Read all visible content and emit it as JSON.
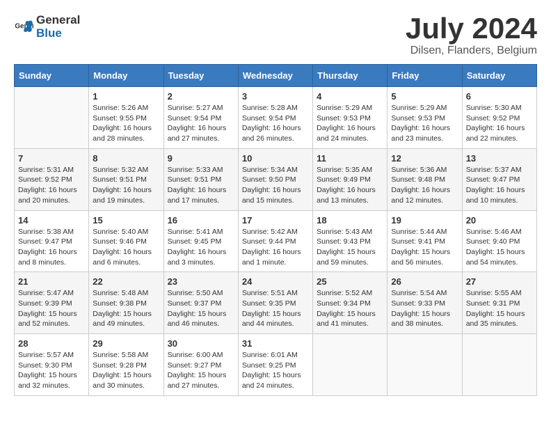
{
  "header": {
    "logo_general": "General",
    "logo_blue": "Blue",
    "month_title": "July 2024",
    "location": "Dilsen, Flanders, Belgium"
  },
  "days_of_week": [
    "Sunday",
    "Monday",
    "Tuesday",
    "Wednesday",
    "Thursday",
    "Friday",
    "Saturday"
  ],
  "weeks": [
    [
      {
        "day": "",
        "info": ""
      },
      {
        "day": "1",
        "info": "Sunrise: 5:26 AM\nSunset: 9:55 PM\nDaylight: 16 hours\nand 28 minutes."
      },
      {
        "day": "2",
        "info": "Sunrise: 5:27 AM\nSunset: 9:54 PM\nDaylight: 16 hours\nand 27 minutes."
      },
      {
        "day": "3",
        "info": "Sunrise: 5:28 AM\nSunset: 9:54 PM\nDaylight: 16 hours\nand 26 minutes."
      },
      {
        "day": "4",
        "info": "Sunrise: 5:29 AM\nSunset: 9:53 PM\nDaylight: 16 hours\nand 24 minutes."
      },
      {
        "day": "5",
        "info": "Sunrise: 5:29 AM\nSunset: 9:53 PM\nDaylight: 16 hours\nand 23 minutes."
      },
      {
        "day": "6",
        "info": "Sunrise: 5:30 AM\nSunset: 9:52 PM\nDaylight: 16 hours\nand 22 minutes."
      }
    ],
    [
      {
        "day": "7",
        "info": "Sunrise: 5:31 AM\nSunset: 9:52 PM\nDaylight: 16 hours\nand 20 minutes."
      },
      {
        "day": "8",
        "info": "Sunrise: 5:32 AM\nSunset: 9:51 PM\nDaylight: 16 hours\nand 19 minutes."
      },
      {
        "day": "9",
        "info": "Sunrise: 5:33 AM\nSunset: 9:51 PM\nDaylight: 16 hours\nand 17 minutes."
      },
      {
        "day": "10",
        "info": "Sunrise: 5:34 AM\nSunset: 9:50 PM\nDaylight: 16 hours\nand 15 minutes."
      },
      {
        "day": "11",
        "info": "Sunrise: 5:35 AM\nSunset: 9:49 PM\nDaylight: 16 hours\nand 13 minutes."
      },
      {
        "day": "12",
        "info": "Sunrise: 5:36 AM\nSunset: 9:48 PM\nDaylight: 16 hours\nand 12 minutes."
      },
      {
        "day": "13",
        "info": "Sunrise: 5:37 AM\nSunset: 9:47 PM\nDaylight: 16 hours\nand 10 minutes."
      }
    ],
    [
      {
        "day": "14",
        "info": "Sunrise: 5:38 AM\nSunset: 9:47 PM\nDaylight: 16 hours\nand 8 minutes."
      },
      {
        "day": "15",
        "info": "Sunrise: 5:40 AM\nSunset: 9:46 PM\nDaylight: 16 hours\nand 6 minutes."
      },
      {
        "day": "16",
        "info": "Sunrise: 5:41 AM\nSunset: 9:45 PM\nDaylight: 16 hours\nand 3 minutes."
      },
      {
        "day": "17",
        "info": "Sunrise: 5:42 AM\nSunset: 9:44 PM\nDaylight: 16 hours\nand 1 minute."
      },
      {
        "day": "18",
        "info": "Sunrise: 5:43 AM\nSunset: 9:43 PM\nDaylight: 15 hours\nand 59 minutes."
      },
      {
        "day": "19",
        "info": "Sunrise: 5:44 AM\nSunset: 9:41 PM\nDaylight: 15 hours\nand 56 minutes."
      },
      {
        "day": "20",
        "info": "Sunrise: 5:46 AM\nSunset: 9:40 PM\nDaylight: 15 hours\nand 54 minutes."
      }
    ],
    [
      {
        "day": "21",
        "info": "Sunrise: 5:47 AM\nSunset: 9:39 PM\nDaylight: 15 hours\nand 52 minutes."
      },
      {
        "day": "22",
        "info": "Sunrise: 5:48 AM\nSunset: 9:38 PM\nDaylight: 15 hours\nand 49 minutes."
      },
      {
        "day": "23",
        "info": "Sunrise: 5:50 AM\nSunset: 9:37 PM\nDaylight: 15 hours\nand 46 minutes."
      },
      {
        "day": "24",
        "info": "Sunrise: 5:51 AM\nSunset: 9:35 PM\nDaylight: 15 hours\nand 44 minutes."
      },
      {
        "day": "25",
        "info": "Sunrise: 5:52 AM\nSunset: 9:34 PM\nDaylight: 15 hours\nand 41 minutes."
      },
      {
        "day": "26",
        "info": "Sunrise: 5:54 AM\nSunset: 9:33 PM\nDaylight: 15 hours\nand 38 minutes."
      },
      {
        "day": "27",
        "info": "Sunrise: 5:55 AM\nSunset: 9:31 PM\nDaylight: 15 hours\nand 35 minutes."
      }
    ],
    [
      {
        "day": "28",
        "info": "Sunrise: 5:57 AM\nSunset: 9:30 PM\nDaylight: 15 hours\nand 32 minutes."
      },
      {
        "day": "29",
        "info": "Sunrise: 5:58 AM\nSunset: 9:28 PM\nDaylight: 15 hours\nand 30 minutes."
      },
      {
        "day": "30",
        "info": "Sunrise: 6:00 AM\nSunset: 9:27 PM\nDaylight: 15 hours\nand 27 minutes."
      },
      {
        "day": "31",
        "info": "Sunrise: 6:01 AM\nSunset: 9:25 PM\nDaylight: 15 hours\nand 24 minutes."
      },
      {
        "day": "",
        "info": ""
      },
      {
        "day": "",
        "info": ""
      },
      {
        "day": "",
        "info": ""
      }
    ]
  ]
}
